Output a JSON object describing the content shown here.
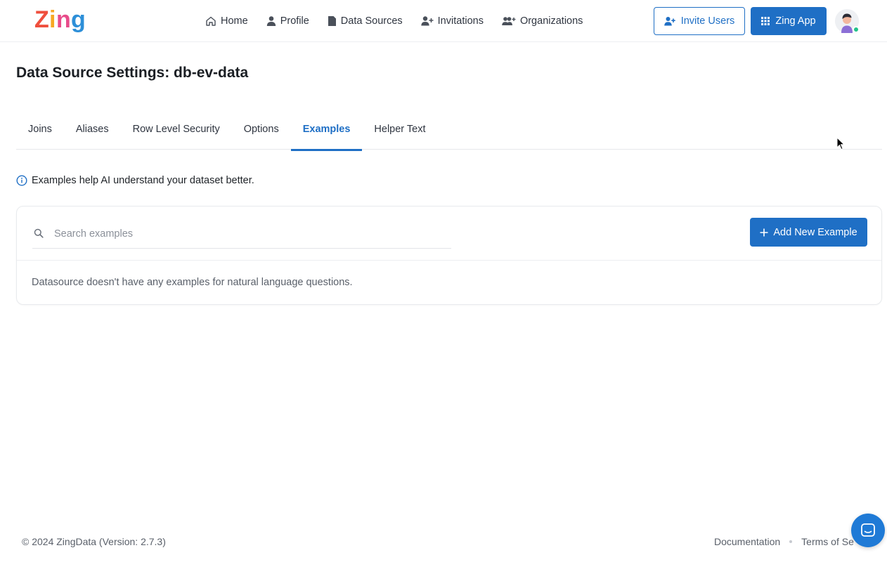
{
  "brand": {
    "logo_text": "Zing"
  },
  "nav": {
    "items": [
      {
        "label": "Home",
        "icon": "home-icon"
      },
      {
        "label": "Profile",
        "icon": "user-icon"
      },
      {
        "label": "Data Sources",
        "icon": "file-icon"
      },
      {
        "label": "Invitations",
        "icon": "user-plus-icon"
      },
      {
        "label": "Organizations",
        "icon": "users-plus-icon"
      }
    ]
  },
  "header_actions": {
    "invite_label": "Invite Users",
    "app_label": "Zing App"
  },
  "page": {
    "title": "Data Source Settings: db-ev-data"
  },
  "tabs": [
    {
      "label": "Joins",
      "active": false
    },
    {
      "label": "Aliases",
      "active": false
    },
    {
      "label": "Row Level Security",
      "active": false
    },
    {
      "label": "Options",
      "active": false
    },
    {
      "label": "Examples",
      "active": true
    },
    {
      "label": "Helper Text",
      "active": false
    }
  ],
  "info": {
    "text": "Examples help AI understand your dataset better."
  },
  "examples": {
    "search_placeholder": "Search examples",
    "search_value": "",
    "add_button_label": "Add New Example",
    "empty_message": "Datasource doesn't have any examples for natural language questions."
  },
  "footer": {
    "copyright": "© 2024 ZingData (Version: 2.7.3)",
    "links": [
      "Documentation",
      "Terms of Se"
    ]
  },
  "colors": {
    "accent": "#1f6fc5",
    "online_status": "#22c28a"
  }
}
